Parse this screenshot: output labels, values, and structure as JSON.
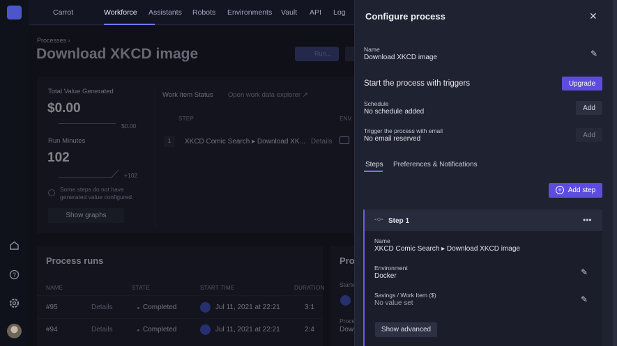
{
  "topnav": {
    "workspace": "Carrot",
    "tabs": [
      "Workforce",
      "Assistants",
      "Robots",
      "Environments",
      "Vault",
      "API",
      "Log"
    ],
    "active": "Workforce"
  },
  "page": {
    "breadcrumb": "Processes",
    "title": "Download XKCD image",
    "run_label": "Run..."
  },
  "stats": {
    "total_label": "Total Value Generated",
    "total_value": "$0.00",
    "total_delta": "$0.00",
    "minutes_label": "Run Minutes",
    "minutes_value": "102",
    "minutes_delta": "+102",
    "note": "Some steps do not have generated value configured.",
    "show_graphs": "Show graphs"
  },
  "work_items": {
    "title": "Work Item Status",
    "explorer": "Open work data explorer",
    "col_step": "STEP",
    "col_env": "ENV.",
    "row_num": "1",
    "row_step": "XKCD Comic Search ▸ Download XK...",
    "row_details": "Details"
  },
  "runs": {
    "title": "Process runs",
    "columns": [
      "NAME",
      "STATE",
      "START TIME",
      "DURATION"
    ],
    "rows": [
      {
        "name": "#95",
        "details": "Details",
        "state": "Completed",
        "start": "Jul 11, 2021 at 22:21",
        "duration": "3:1"
      },
      {
        "name": "#94",
        "details": "Details",
        "state": "Completed",
        "start": "Jul 11, 2021 at 22:21",
        "duration": "2:4"
      }
    ]
  },
  "side_card": {
    "title": "Proc",
    "started": "Starte",
    "proc": "Proce",
    "down": "Down"
  },
  "panel": {
    "title": "Configure process",
    "name_label": "Name",
    "name_value": "Download XKCD image",
    "triggers_title": "Start the process with triggers",
    "upgrade": "Upgrade",
    "schedule_label": "Schedule",
    "schedule_value": "No schedule added",
    "add": "Add",
    "email_label": "Trigger the process with email",
    "email_value": "No email reserved",
    "tabs": [
      "Steps",
      "Preferences & Notifications"
    ],
    "add_step": "Add step",
    "step": {
      "title": "Step 1",
      "name_label": "Name",
      "name_value": "XKCD Comic Search ▸ Download XKCD image",
      "env_label": "Environment",
      "env_value": "Docker",
      "savings_label": "Savings / Work Item ($)",
      "savings_value": "No value set",
      "advanced": "Show advanced"
    }
  }
}
